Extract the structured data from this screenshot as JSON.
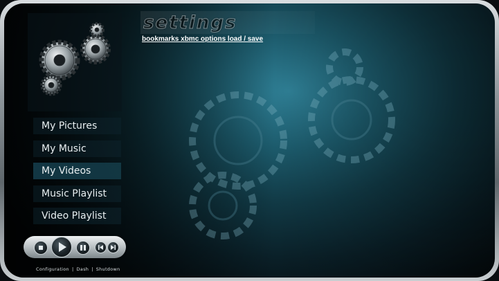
{
  "header": {
    "title": "settings",
    "breadcrumb": "bookmarks xbmc options load / save"
  },
  "menu": {
    "items": [
      {
        "label": "My Pictures"
      },
      {
        "label": "My Music"
      },
      {
        "label": "My Videos"
      },
      {
        "label": "Music Playlist"
      },
      {
        "label": "Video Playlist"
      }
    ]
  },
  "transport": {
    "buttons": [
      {
        "icon": "stop-icon"
      },
      {
        "icon": "play-icon"
      },
      {
        "icon": "pause-icon"
      },
      {
        "icon": "previous-icon"
      },
      {
        "icon": "next-icon"
      }
    ]
  },
  "footer": {
    "links": [
      {
        "label": "Configuration"
      },
      {
        "label": "Dash"
      },
      {
        "label": "Shutdown"
      }
    ],
    "separator": "|"
  },
  "colors": {
    "accent": "#2f7f95",
    "frame": "#8c9499",
    "text": "#e8eef0"
  }
}
